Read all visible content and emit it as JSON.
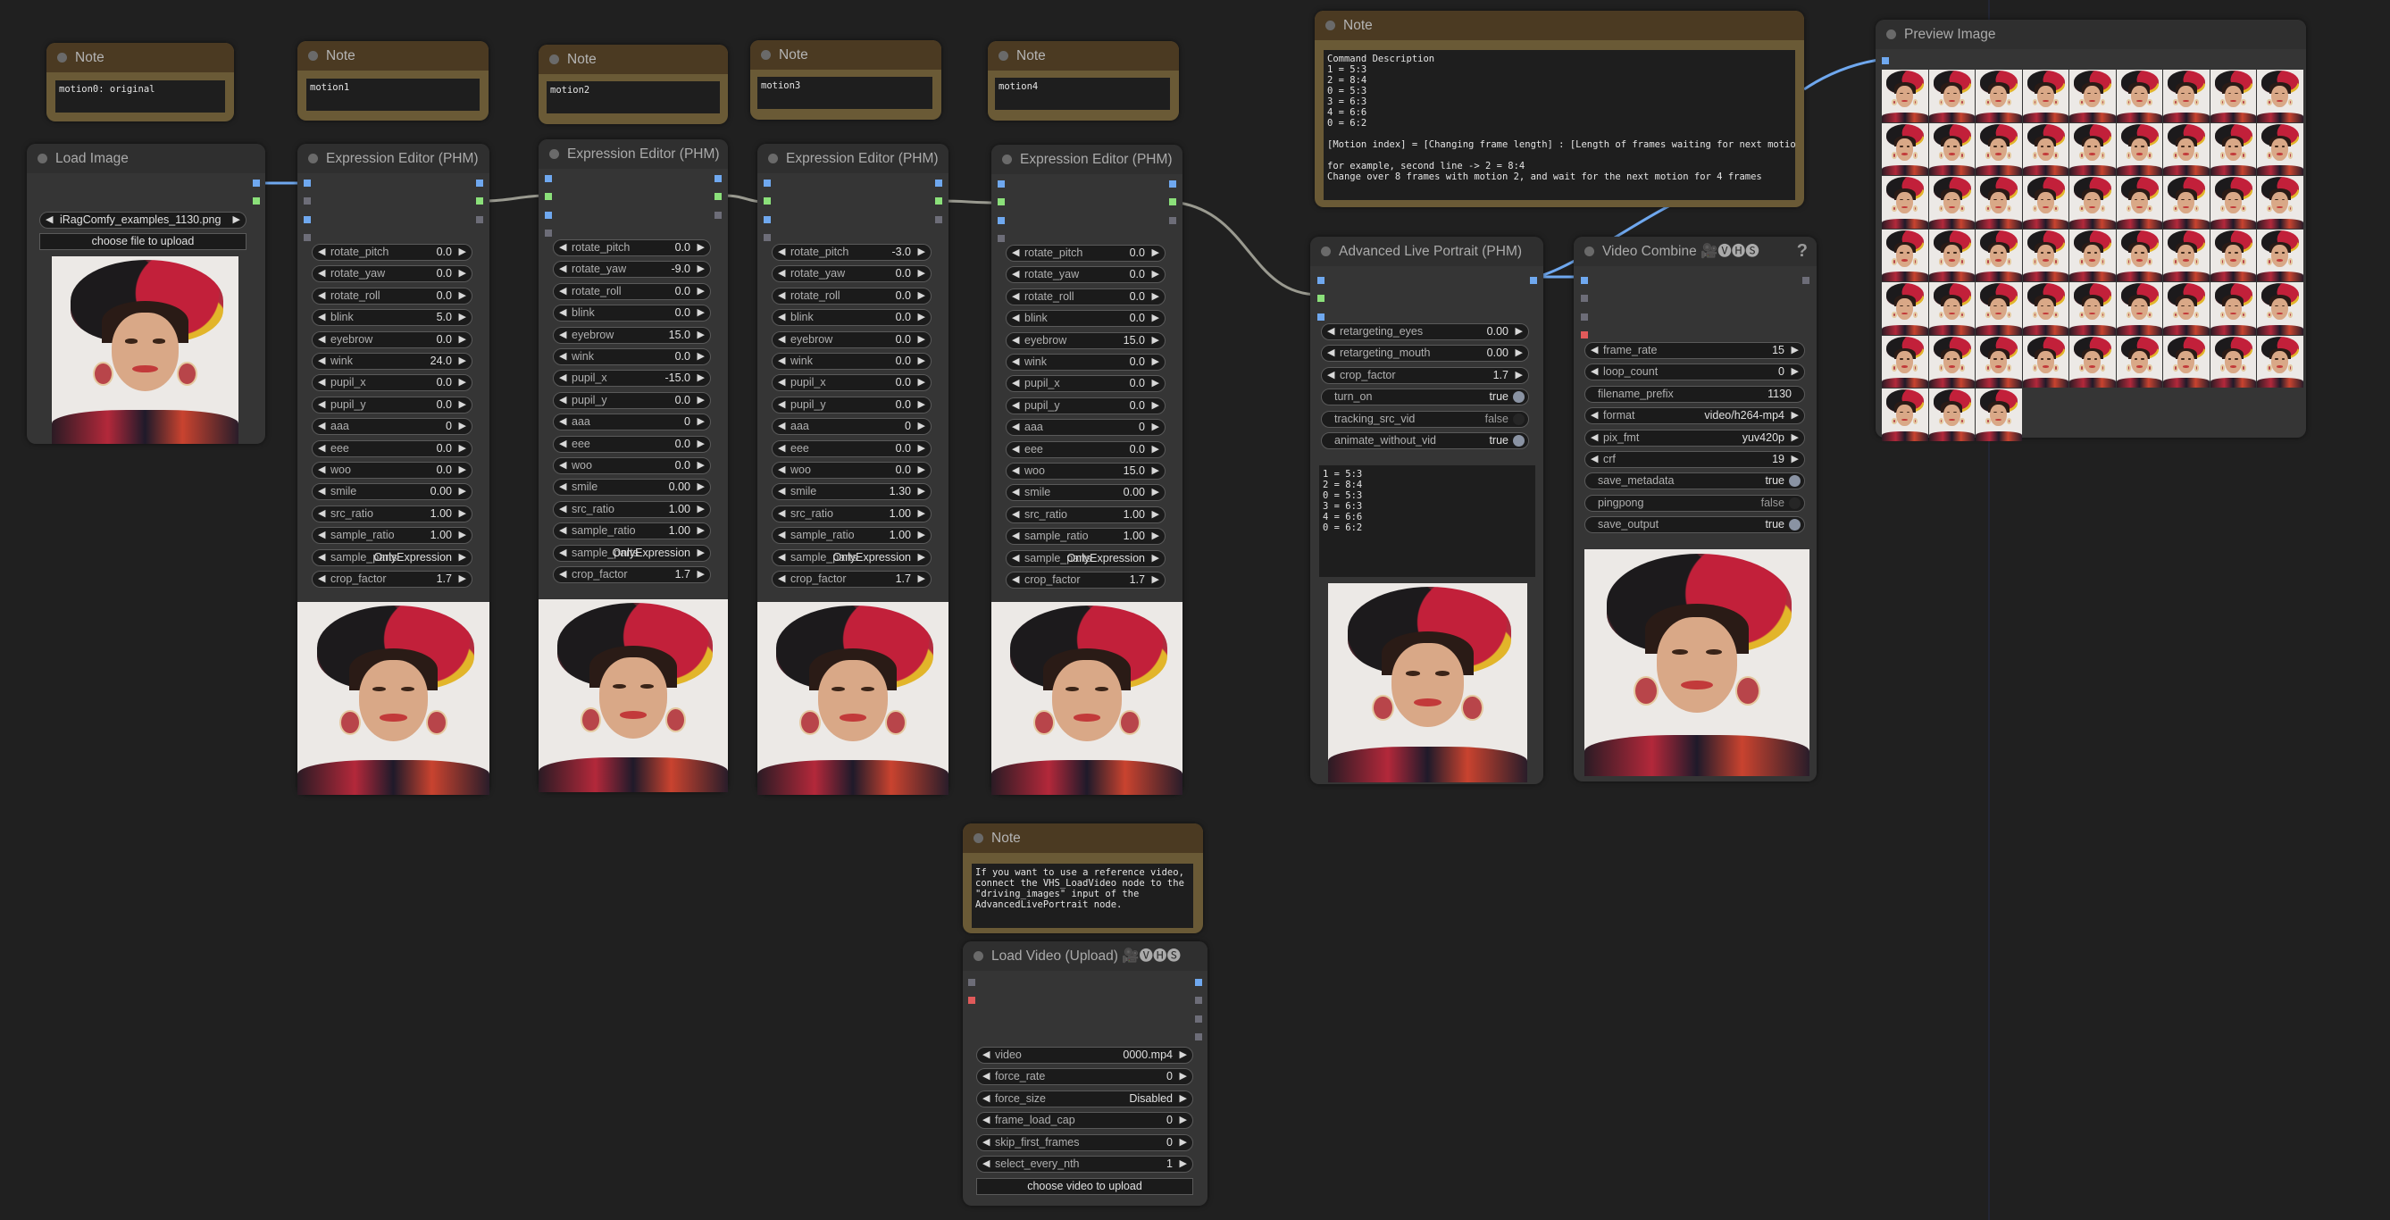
{
  "notes": [
    {
      "title": "Note",
      "text": "motion0: original"
    },
    {
      "title": "Note",
      "text": "motion1"
    },
    {
      "title": "Note",
      "text": "motion2"
    },
    {
      "title": "Note",
      "text": "motion3"
    },
    {
      "title": "Note",
      "text": "motion4"
    }
  ],
  "command_note": {
    "title": "Note",
    "text": "Command Description\n1 = 5:3\n2 = 8:4\n0 = 5:3\n3 = 6:3\n4 = 6:6\n0 = 6:2\n\n[Motion index] = [Changing frame length] : [Length of frames waiting for next motion]\n\nfor example, second line -> 2 = 8:4\nChange over 8 frames with motion 2, and wait for the next motion for 4 frames"
  },
  "video_note": {
    "title": "Note",
    "text": "If you want to use a reference video,\nconnect the VHS_LoadVideo node to the\n\"driving_images\" input of the\nAdvancedLivePortrait node."
  },
  "load_image": {
    "title": "Load Image",
    "image_value": "iRagComfy_examples_1130.png",
    "upload_label": "choose file to upload"
  },
  "expression_editors": [
    {
      "title": "Expression Editor (PHM)",
      "widgets": [
        {
          "label": "rotate_pitch",
          "value": "0.0"
        },
        {
          "label": "rotate_yaw",
          "value": "0.0"
        },
        {
          "label": "rotate_roll",
          "value": "0.0"
        },
        {
          "label": "blink",
          "value": "5.0"
        },
        {
          "label": "eyebrow",
          "value": "0.0"
        },
        {
          "label": "wink",
          "value": "24.0"
        },
        {
          "label": "pupil_x",
          "value": "0.0"
        },
        {
          "label": "pupil_y",
          "value": "0.0"
        },
        {
          "label": "aaa",
          "value": "0"
        },
        {
          "label": "eee",
          "value": "0.0"
        },
        {
          "label": "woo",
          "value": "0.0"
        },
        {
          "label": "smile",
          "value": "0.00"
        },
        {
          "label": "src_ratio",
          "value": "1.00"
        },
        {
          "label": "sample_ratio",
          "value": "1.00"
        },
        {
          "label": "sample_parts",
          "value": "OnlyExpression"
        },
        {
          "label": "crop_factor",
          "value": "1.7"
        }
      ]
    },
    {
      "title": "Expression Editor (PHM)",
      "widgets": [
        {
          "label": "rotate_pitch",
          "value": "0.0"
        },
        {
          "label": "rotate_yaw",
          "value": "-9.0"
        },
        {
          "label": "rotate_roll",
          "value": "0.0"
        },
        {
          "label": "blink",
          "value": "0.0"
        },
        {
          "label": "eyebrow",
          "value": "15.0"
        },
        {
          "label": "wink",
          "value": "0.0"
        },
        {
          "label": "pupil_x",
          "value": "-15.0"
        },
        {
          "label": "pupil_y",
          "value": "0.0"
        },
        {
          "label": "aaa",
          "value": "0"
        },
        {
          "label": "eee",
          "value": "0.0"
        },
        {
          "label": "woo",
          "value": "0.0"
        },
        {
          "label": "smile",
          "value": "0.00"
        },
        {
          "label": "src_ratio",
          "value": "1.00"
        },
        {
          "label": "sample_ratio",
          "value": "1.00"
        },
        {
          "label": "sample_parts",
          "value": "OnlyExpression"
        },
        {
          "label": "crop_factor",
          "value": "1.7"
        }
      ]
    },
    {
      "title": "Expression Editor (PHM)",
      "widgets": [
        {
          "label": "rotate_pitch",
          "value": "-3.0"
        },
        {
          "label": "rotate_yaw",
          "value": "0.0"
        },
        {
          "label": "rotate_roll",
          "value": "0.0"
        },
        {
          "label": "blink",
          "value": "0.0"
        },
        {
          "label": "eyebrow",
          "value": "0.0"
        },
        {
          "label": "wink",
          "value": "0.0"
        },
        {
          "label": "pupil_x",
          "value": "0.0"
        },
        {
          "label": "pupil_y",
          "value": "0.0"
        },
        {
          "label": "aaa",
          "value": "0"
        },
        {
          "label": "eee",
          "value": "0.0"
        },
        {
          "label": "woo",
          "value": "0.0"
        },
        {
          "label": "smile",
          "value": "1.30"
        },
        {
          "label": "src_ratio",
          "value": "1.00"
        },
        {
          "label": "sample_ratio",
          "value": "1.00"
        },
        {
          "label": "sample_parts",
          "value": "OnlyExpression"
        },
        {
          "label": "crop_factor",
          "value": "1.7"
        }
      ]
    },
    {
      "title": "Expression Editor (PHM)",
      "widgets": [
        {
          "label": "rotate_pitch",
          "value": "0.0"
        },
        {
          "label": "rotate_yaw",
          "value": "0.0"
        },
        {
          "label": "rotate_roll",
          "value": "0.0"
        },
        {
          "label": "blink",
          "value": "0.0"
        },
        {
          "label": "eyebrow",
          "value": "15.0"
        },
        {
          "label": "wink",
          "value": "0.0"
        },
        {
          "label": "pupil_x",
          "value": "0.0"
        },
        {
          "label": "pupil_y",
          "value": "0.0"
        },
        {
          "label": "aaa",
          "value": "0"
        },
        {
          "label": "eee",
          "value": "0.0"
        },
        {
          "label": "woo",
          "value": "15.0"
        },
        {
          "label": "smile",
          "value": "0.00"
        },
        {
          "label": "src_ratio",
          "value": "1.00"
        },
        {
          "label": "sample_ratio",
          "value": "1.00"
        },
        {
          "label": "sample_parts",
          "value": "OnlyExpression"
        },
        {
          "label": "crop_factor",
          "value": "1.7"
        }
      ]
    }
  ],
  "live_portrait": {
    "title": "Advanced Live Portrait (PHM)",
    "widgets": [
      {
        "label": "retargeting_eyes",
        "value": "0.00",
        "kind": "number"
      },
      {
        "label": "retargeting_mouth",
        "value": "0.00",
        "kind": "number"
      },
      {
        "label": "crop_factor",
        "value": "1.7",
        "kind": "number"
      },
      {
        "label": "turn_on",
        "value": "true",
        "kind": "toggle"
      },
      {
        "label": "tracking_src_vid",
        "value": "false",
        "kind": "toggle"
      },
      {
        "label": "animate_without_vid",
        "value": "true",
        "kind": "toggle"
      }
    ],
    "command": "1 = 5:3\n2 = 8:4\n0 = 5:3\n3 = 6:3\n4 = 6:6\n0 = 6:2"
  },
  "video_combine": {
    "title": "Video Combine 🎥🅥🅗🅢",
    "help": "?",
    "widgets": [
      {
        "label": "frame_rate",
        "value": "15",
        "kind": "number"
      },
      {
        "label": "loop_count",
        "value": "0",
        "kind": "number"
      },
      {
        "label": "filename_prefix",
        "value": "1130",
        "kind": "text"
      },
      {
        "label": "format",
        "value": "video/h264-mp4",
        "kind": "number"
      },
      {
        "label": "pix_fmt",
        "value": "yuv420p",
        "kind": "number"
      },
      {
        "label": "crf",
        "value": "19",
        "kind": "number"
      },
      {
        "label": "save_metadata",
        "value": "true",
        "kind": "toggle"
      },
      {
        "label": "pingpong",
        "value": "false",
        "kind": "toggle"
      },
      {
        "label": "save_output",
        "value": "true",
        "kind": "toggle"
      }
    ]
  },
  "preview_image": {
    "title": "Preview Image",
    "frame_count": 57,
    "columns": 9
  },
  "load_video": {
    "title": "Load Video (Upload) 🎥🅥🅗🅢",
    "widgets": [
      {
        "label": "video",
        "value": "0000.mp4"
      },
      {
        "label": "force_rate",
        "value": "0"
      },
      {
        "label": "force_size",
        "value": "Disabled"
      },
      {
        "label": "frame_load_cap",
        "value": "0"
      },
      {
        "label": "skip_first_frames",
        "value": "0"
      },
      {
        "label": "select_every_nth",
        "value": "1"
      }
    ],
    "upload_label": "choose video to upload"
  },
  "colors": {
    "image_link": "#6fa8ef",
    "live_portrait_link": "#9a9a90",
    "note_body": "#6a5a36",
    "note_header": "#4b3a22"
  }
}
